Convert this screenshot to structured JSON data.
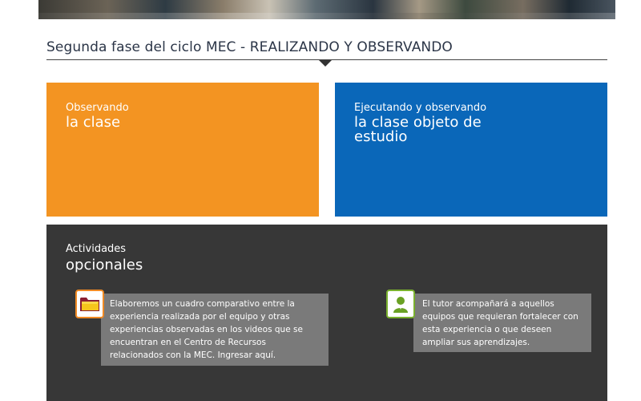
{
  "hero": {
    "alt": "photo-strip"
  },
  "section": {
    "title": "Segunda fase del ciclo MEC - REALIZANDO Y OBSERVANDO"
  },
  "cards": [
    {
      "small": "Observando",
      "large": "la clase",
      "color": "#f39422"
    },
    {
      "small": "Ejecutando y observando",
      "large": "la clase objeto de estudio",
      "color": "#0a67b9"
    }
  ],
  "optional": {
    "small": "Actividades",
    "large": "opcionales",
    "color": "#373737",
    "activities": [
      {
        "icon": "folder-icon",
        "text": "Elaboremos un cuadro comparativo entre la experiencia realizada por el equipo y otras experiencias observadas en los videos que se encuentran en el Centro de Recursos relacionados con la MEC. Ingresar aquí."
      },
      {
        "icon": "user-icon",
        "text": "El tutor acompañará a aquellos equipos que requieran fortalecer con esta experiencia o que deseen ampliar sus aprendizajes."
      }
    ]
  }
}
